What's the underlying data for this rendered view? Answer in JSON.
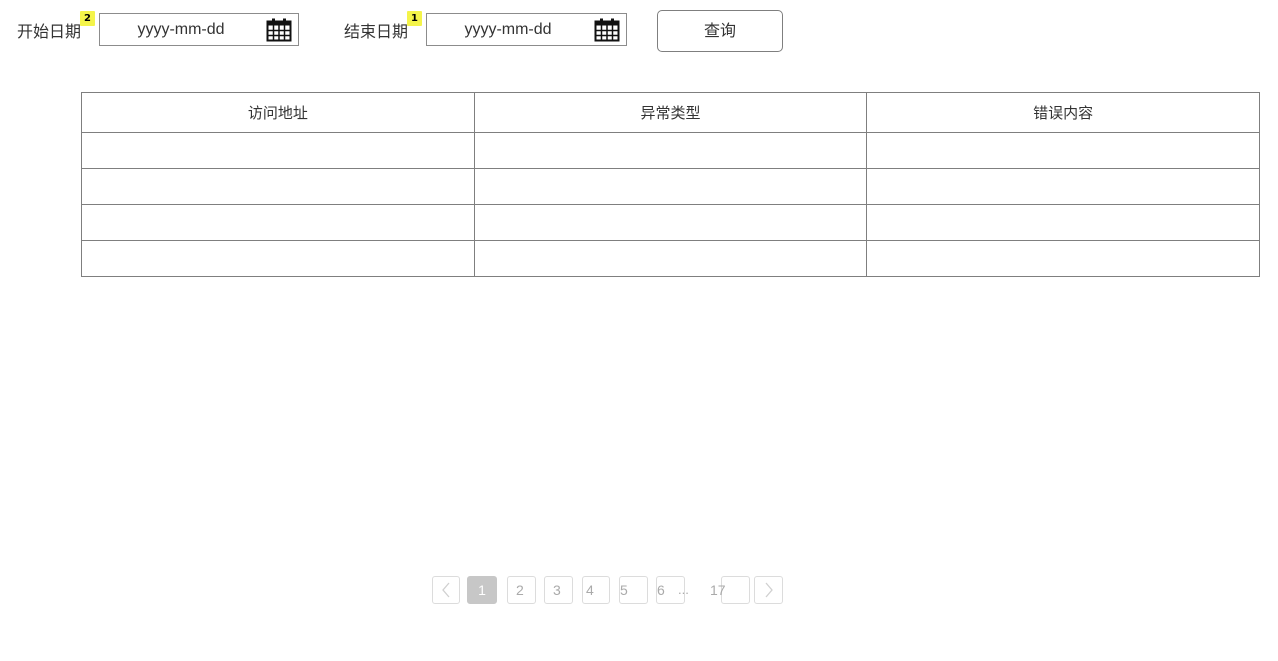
{
  "filters": {
    "start": {
      "label": "开始日期",
      "badge": "2",
      "placeholder": "yyyy-mm-dd",
      "icon": "calendar-icon"
    },
    "end": {
      "label": "结束日期",
      "badge": "1",
      "placeholder": "yyyy-mm-dd",
      "icon": "calendar-icon"
    },
    "query_label": "查询"
  },
  "table": {
    "columns": [
      "访问地址",
      "异常类型",
      "错误内容"
    ],
    "rows": [
      [
        "",
        "",
        ""
      ],
      [
        "",
        "",
        ""
      ],
      [
        "",
        "",
        ""
      ],
      [
        "",
        "",
        ""
      ]
    ]
  },
  "pagination": {
    "current": "1",
    "pages": [
      "2",
      "3",
      "4",
      "5",
      "6"
    ],
    "ellipsis": "...",
    "last": "17",
    "prev_icon": "chevron-left-icon",
    "next_icon": "chevron-right-icon"
  },
  "colors": {
    "badge": "#f4f44a",
    "active_page": "#c7c7c7",
    "border": "#7f7f7f"
  }
}
